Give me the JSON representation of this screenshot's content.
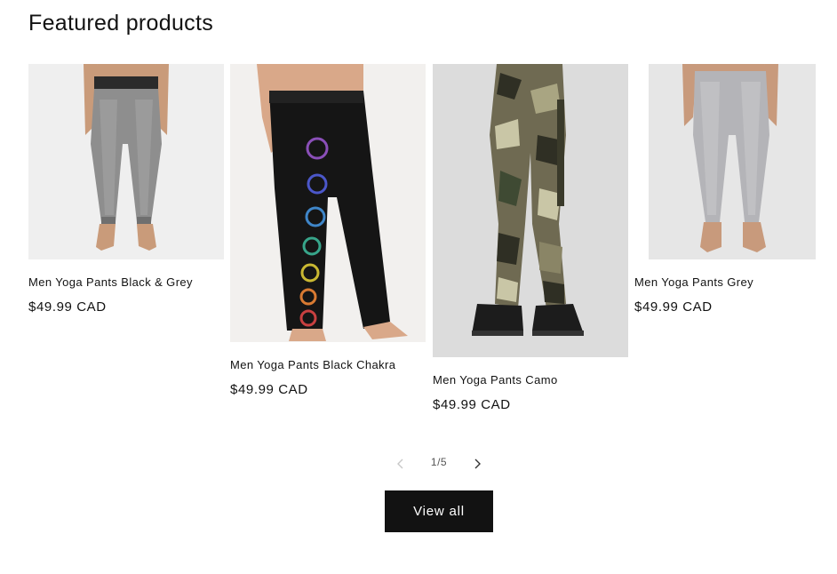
{
  "section": {
    "title": "Featured products"
  },
  "products": [
    {
      "title": "Men Yoga Pants Black & Grey",
      "price": "$49.99 CAD"
    },
    {
      "title": "Men Yoga Pants Black Chakra",
      "price": "$49.99 CAD"
    },
    {
      "title": "Men Yoga Pants Camo",
      "price": "$49.99 CAD"
    },
    {
      "title": "Men Yoga Pants Grey",
      "price": "$49.99 CAD"
    }
  ],
  "pager": {
    "count": "1/5",
    "prev_icon": "chevron-left-icon",
    "next_icon": "chevron-right-icon"
  },
  "actions": {
    "view_all_label": "View all"
  },
  "colors": {
    "button_bg": "#121212",
    "text": "#121212"
  }
}
